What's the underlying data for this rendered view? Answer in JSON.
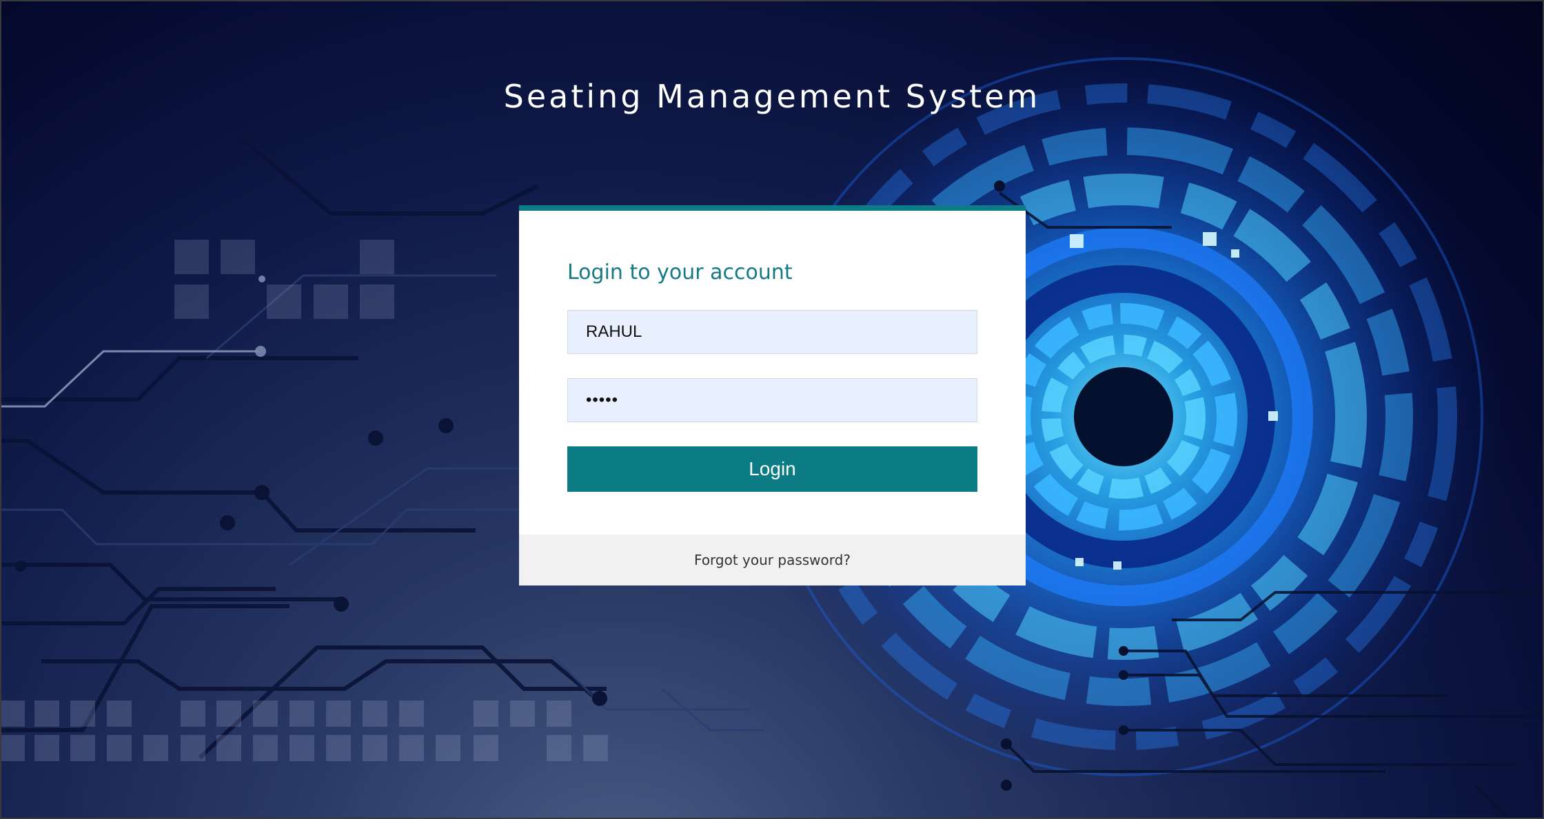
{
  "page": {
    "title": "Seating Management System"
  },
  "login_card": {
    "heading": "Login to your account",
    "username_value": "RAHUL",
    "password_value": "•••••",
    "login_label": "Login",
    "forgot_label": "Forgot your password?"
  },
  "colors": {
    "accent": "#0b7c84",
    "input_bg": "#e8f0fe",
    "background_dark": "#050a30",
    "eye_glow": "#19a6ff"
  }
}
